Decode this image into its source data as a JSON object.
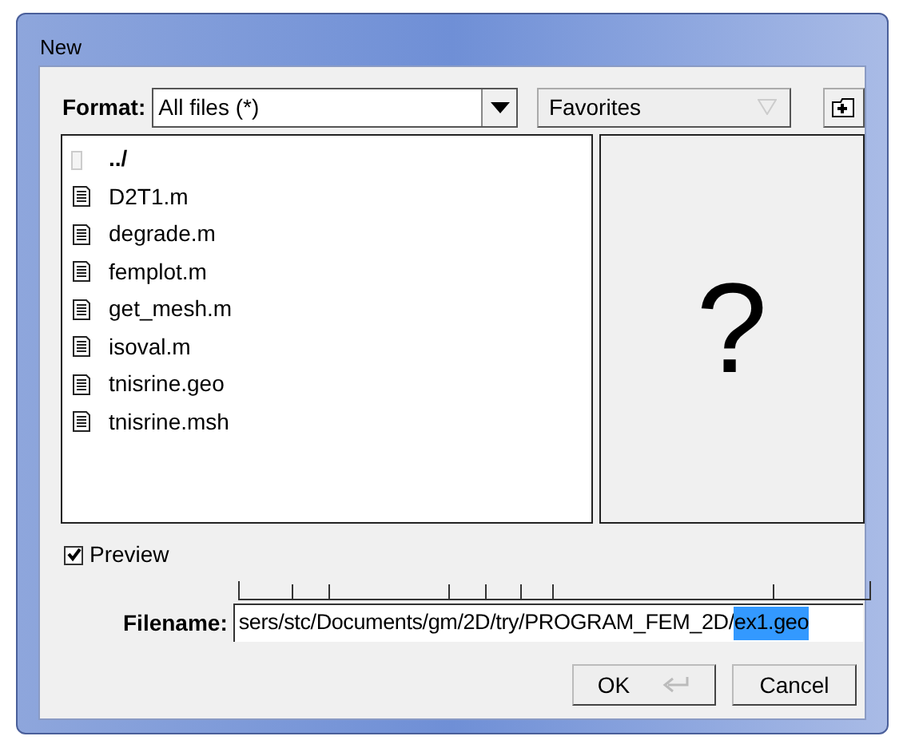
{
  "window": {
    "title": "New"
  },
  "format": {
    "label": "Format:",
    "value": "All files (*)"
  },
  "favorites": {
    "label": "Favorites"
  },
  "files": [
    {
      "name": "../",
      "kind": "folder"
    },
    {
      "name": "D2T1.m",
      "kind": "file"
    },
    {
      "name": "degrade.m",
      "kind": "file"
    },
    {
      "name": "femplot.m",
      "kind": "file"
    },
    {
      "name": "get_mesh.m",
      "kind": "file"
    },
    {
      "name": "isoval.m",
      "kind": "file"
    },
    {
      "name": "tnisrine.geo",
      "kind": "file"
    },
    {
      "name": "tnisrine.msh",
      "kind": "file"
    }
  ],
  "preview_pane": {
    "glyph": "?"
  },
  "preview": {
    "label": "Preview",
    "checked": true
  },
  "filename": {
    "label": "Filename:",
    "value": "sers/stc/Documents/gm/2D/try/PROGRAM_FEM_2D/",
    "selected_text": "ex1.geo"
  },
  "buttons": [
    {
      "label": "OK",
      "kind": "default"
    },
    {
      "label": "Cancel",
      "kind": "plain"
    }
  ]
}
